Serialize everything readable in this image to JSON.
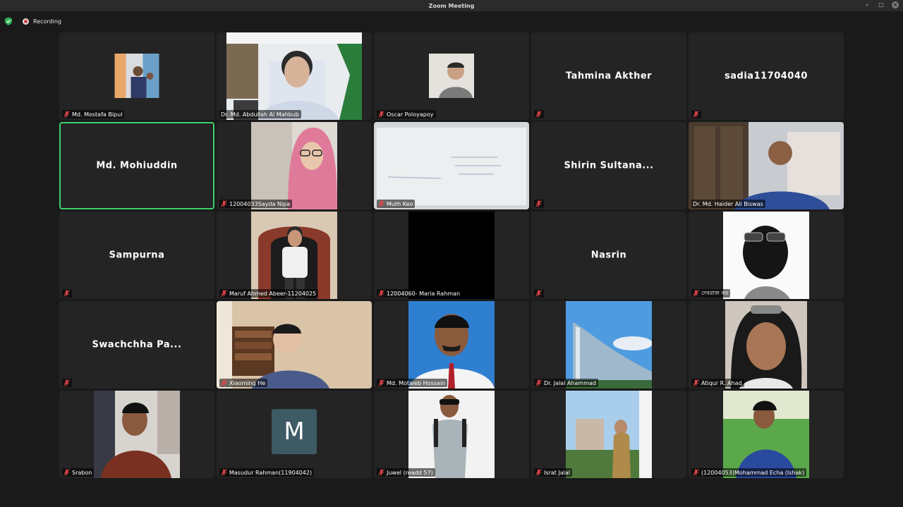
{
  "window": {
    "title": "Zoom Meeting"
  },
  "toolbar": {
    "recording_label": "Recording",
    "icons": [
      "shield-icon",
      "recording-icon"
    ]
  },
  "participants": [
    {
      "name": "Md. Mostafa Bipul",
      "video": true,
      "muted": true
    },
    {
      "name": "Dr. Md. Abdullah Al Mahbub",
      "video": true,
      "muted": false
    },
    {
      "name": "Oscar Poloyapoy",
      "video": true,
      "muted": true
    },
    {
      "name": "Tahmina Akther",
      "video": false,
      "muted": true
    },
    {
      "name": "sadia11704040",
      "video": false,
      "muted": true
    },
    {
      "name": "Md. Mohiuddin",
      "video": false,
      "muted": false,
      "active_speaker": true
    },
    {
      "name": "12004033Sayda Nipa",
      "video": true,
      "muted": true
    },
    {
      "name": "Muth Keo",
      "video": true,
      "muted": true
    },
    {
      "name": "Shirin Sultana...",
      "video": false,
      "muted": true
    },
    {
      "name": "Dr. Md. Haider Ali Biswas",
      "video": true,
      "muted": false
    },
    {
      "name": "Sampurna",
      "video": false,
      "muted": true
    },
    {
      "name": "Maruf Ahmed Abeer-11204025",
      "video": true,
      "muted": true
    },
    {
      "name": "12004060- Maria Rahman",
      "video": true,
      "muted": true
    },
    {
      "name": "Nasrin",
      "video": false,
      "muted": true
    },
    {
      "name": "দেবরাজ কর",
      "video": true,
      "muted": true
    },
    {
      "name": "Swachchha Pa...",
      "video": false,
      "muted": true
    },
    {
      "name": "Xiaoming He",
      "video": true,
      "muted": true
    },
    {
      "name": "Md. Motaleb Hossain",
      "video": true,
      "muted": true
    },
    {
      "name": "Dr. Jalal Ahammad",
      "video": true,
      "muted": true
    },
    {
      "name": "Atiqur R. Ahad",
      "video": true,
      "muted": true
    },
    {
      "name": "Srabon",
      "video": true,
      "muted": true
    },
    {
      "name": "Masudur Rahman(11904042)",
      "video": false,
      "muted": true,
      "avatar_letter": "M"
    },
    {
      "name": "Juwel (readd 57)",
      "video": true,
      "muted": true
    },
    {
      "name": "Israt Jalal",
      "video": true,
      "muted": true
    },
    {
      "name": "(12004053)Mohammad Echa (Ishak)",
      "video": true,
      "muted": true
    }
  ],
  "colors": {
    "background": "#1a1a1a",
    "tile": "#242424",
    "active_speaker_border": "#3ecf6a",
    "mute_icon": "#e0444a"
  }
}
